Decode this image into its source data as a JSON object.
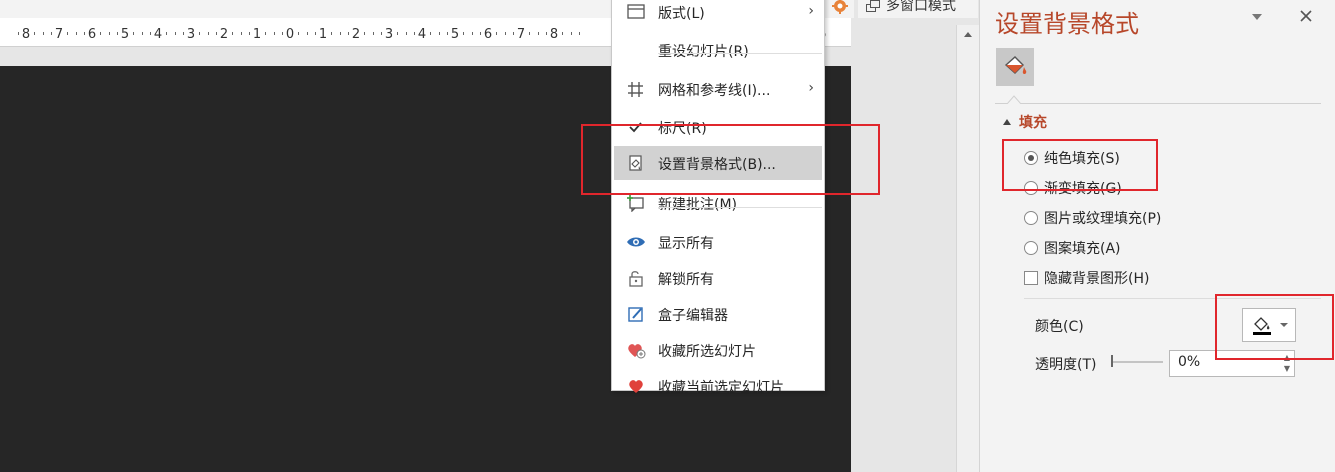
{
  "ruler": {
    "numbers": [
      "8",
      "7",
      "6",
      "5",
      "4",
      "3",
      "2",
      "1",
      "0",
      "1",
      "2",
      "3",
      "4",
      "5",
      "6",
      "7",
      "8"
    ],
    "end_number": "6"
  },
  "toolbar": {
    "multi_window_label": "多窗口模式"
  },
  "context_menu": {
    "items": [
      {
        "label": "版式(L)",
        "icon": "layout-icon",
        "submenu": true
      },
      {
        "label": "重设幻灯片(R)",
        "icon": "none"
      },
      {
        "label": "网格和参考线(I)...",
        "icon": "grid-icon",
        "submenu": true
      },
      {
        "label": "标尺(R)",
        "icon": "checkmark-icon"
      },
      {
        "label": "设置背景格式(B)...",
        "icon": "format-background-icon",
        "highlighted": true
      },
      {
        "label": "新建批注(M)",
        "icon": "new-comment-icon"
      },
      {
        "label": "显示所有",
        "icon": "eye-icon"
      },
      {
        "label": "解锁所有",
        "icon": "unlock-icon"
      },
      {
        "label": "盒子编辑器",
        "icon": "edit-icon"
      },
      {
        "label": "收藏所选幻灯片",
        "icon": "heart-add-icon"
      },
      {
        "label": "收藏当前选定幻灯片",
        "icon": "heart-icon"
      }
    ]
  },
  "format_pane": {
    "title": "设置背景格式",
    "section_fill": "填充",
    "options": [
      {
        "label": "纯色填充(S)",
        "type": "radio",
        "selected": true
      },
      {
        "label": "渐变填充(G)",
        "type": "radio",
        "selected": false
      },
      {
        "label": "图片或纹理填充(P)",
        "type": "radio",
        "selected": false
      },
      {
        "label": "图案填充(A)",
        "type": "radio",
        "selected": false
      },
      {
        "label": "隐藏背景图形(H)",
        "type": "checkbox",
        "checked": false
      }
    ],
    "color_label": "颜色(C)",
    "transparency_label": "透明度(T)",
    "transparency_value": "0%",
    "transparency_fraction": 0
  },
  "colors": {
    "accent": "#b7472a",
    "slide_background": "#262626",
    "annotation_red": "#e0262c",
    "menu_highlight": "#d2d2d2"
  }
}
